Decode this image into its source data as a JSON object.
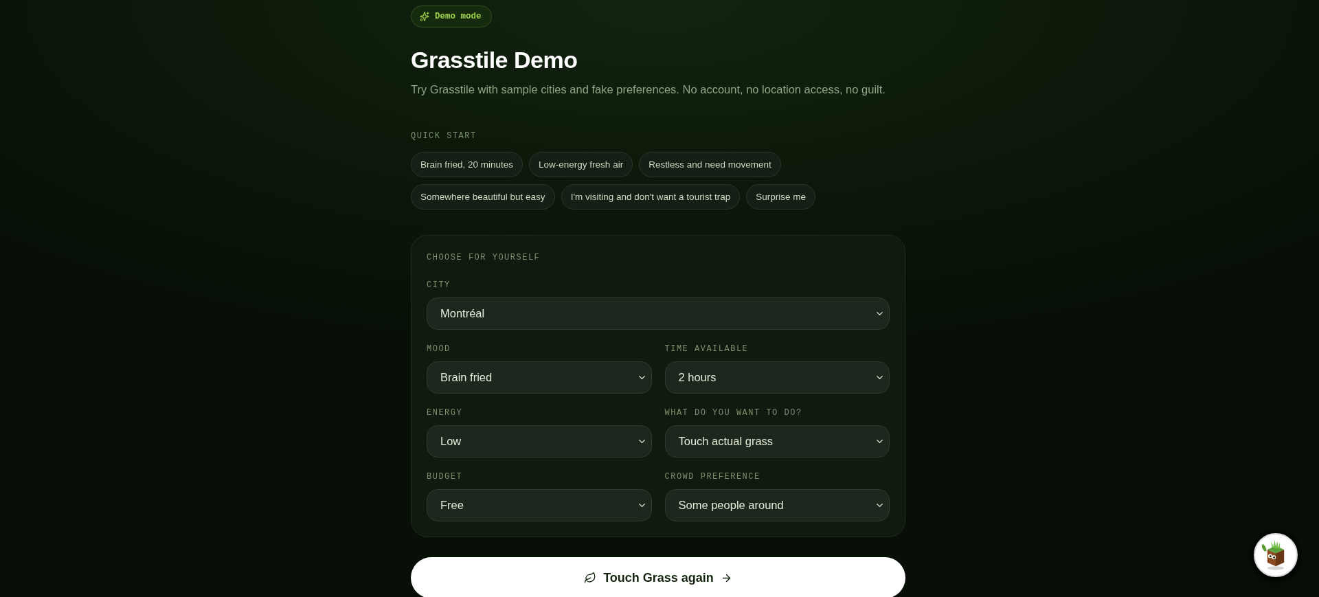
{
  "badge": {
    "label": "Demo mode"
  },
  "title": "Grasstile Demo",
  "subtitle": "Try Grasstile with sample cities and fake preferences. No account, no location access, no guilt.",
  "quick_start": {
    "heading": "QUICK START",
    "chips": [
      "Brain fried, 20 minutes",
      "Low-energy fresh air",
      "Restless and need movement",
      "Somewhere beautiful but easy",
      "I'm visiting and don't want a tourist trap",
      "Surprise me"
    ]
  },
  "form": {
    "heading": "CHOOSE FOR YOURSELF",
    "city": {
      "label": "CITY",
      "value": "Montréal"
    },
    "fields": [
      {
        "label": "MOOD",
        "value": "Brain fried"
      },
      {
        "label": "TIME AVAILABLE",
        "value": "2 hours"
      },
      {
        "label": "ENERGY",
        "value": "Low"
      },
      {
        "label": "WHAT DO YOU WANT TO DO?",
        "value": "Touch actual grass"
      },
      {
        "label": "BUDGET",
        "value": "Free"
      },
      {
        "label": "CROWD PREFERENCE",
        "value": "Some people around"
      }
    ]
  },
  "submit_button": {
    "label": "Touch Grass again"
  }
}
